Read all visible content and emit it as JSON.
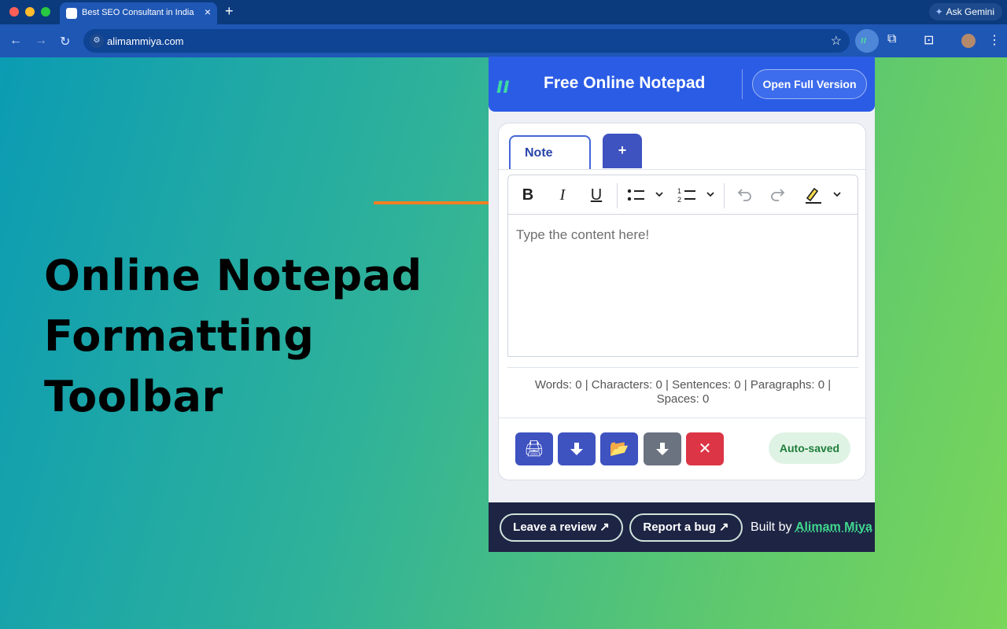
{
  "browser": {
    "tab_title": "Best SEO Consultant in India",
    "tab_close": "×",
    "new_tab": "+",
    "gemini_label": "Ask Gemini",
    "url": "alimammiya.com"
  },
  "headline": {
    "line1": "Online Notepad",
    "line2": "Formatting Toolbar"
  },
  "popup": {
    "header": {
      "title": "Free Online Notepad",
      "open_full": "Open Full Version"
    },
    "tabs": [
      {
        "label": "Note"
      },
      {
        "label": "+"
      }
    ],
    "formatting": {
      "bold": "B",
      "italic": "I",
      "underline": "U"
    },
    "editor": {
      "placeholder": "Type the content here!"
    },
    "stats": {
      "line1": "Words: 0 | Characters: 0 | Sentences: 0 | Paragraphs: 0 |",
      "line2": "Spaces: 0"
    },
    "status": "Auto-saved",
    "footer": {
      "review": "Leave a review ↗",
      "bug": "Report a bug ↗",
      "built_by": "Built by",
      "author": "Alimam Miya"
    }
  },
  "colors": {
    "header_blue": "#2b5ce6",
    "action_blue": "#3e52c0",
    "action_gray": "#6b7280",
    "action_red": "#dc3545",
    "arrow_orange": "#f07f22",
    "footer_navy": "#1e2444",
    "accent_green": "#3fd98f"
  }
}
